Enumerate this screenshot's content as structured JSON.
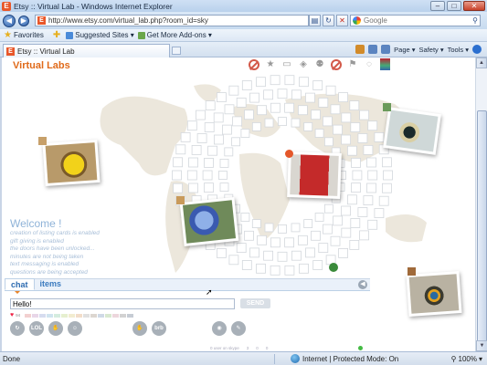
{
  "window": {
    "title": "Etsy :: Virtual Lab - Windows Internet Explorer"
  },
  "address": {
    "url": "http://www.etsy.com/virtual_lab.php?room_id=sky",
    "search_placeholder": "Google"
  },
  "favorites": {
    "favorites_label": "Favorites",
    "suggested_sites": "Suggested Sites ▾",
    "addons": "Get More Add-ons ▾"
  },
  "tab": {
    "label": "Etsy :: Virtual Lab"
  },
  "commandbar": {
    "page": "Page ▾",
    "safety": "Safety ▾",
    "tools": "Tools ▾",
    "help": "? ▾"
  },
  "page": {
    "title": "Virtual Labs",
    "welcome_heading": "Welcome !",
    "welcome_lines": [
      "creation of listing cards is enabled",
      "gift giving is enabled",
      "the doors have been unlocked...",
      "minutes are not being taken",
      "text messaging is enabled",
      "questions are being accepted"
    ]
  },
  "chat": {
    "tab_chat": "chat",
    "tab_items": "items",
    "message_value": "Hello!",
    "send_label": "SEND",
    "heart_count": "94",
    "emotes": [
      "↻",
      "LOL",
      "✋",
      "☺",
      "✋",
      "brb",
      "◉",
      "✎"
    ],
    "status_bits": [
      "0 user on skype",
      "3",
      "0",
      "0"
    ]
  },
  "status": {
    "done": "Done",
    "zone": "Internet | Protected Mode: On",
    "zoom": "100%"
  },
  "colors": {
    "accent": "#e06a1a",
    "link": "#2d6bb0"
  }
}
